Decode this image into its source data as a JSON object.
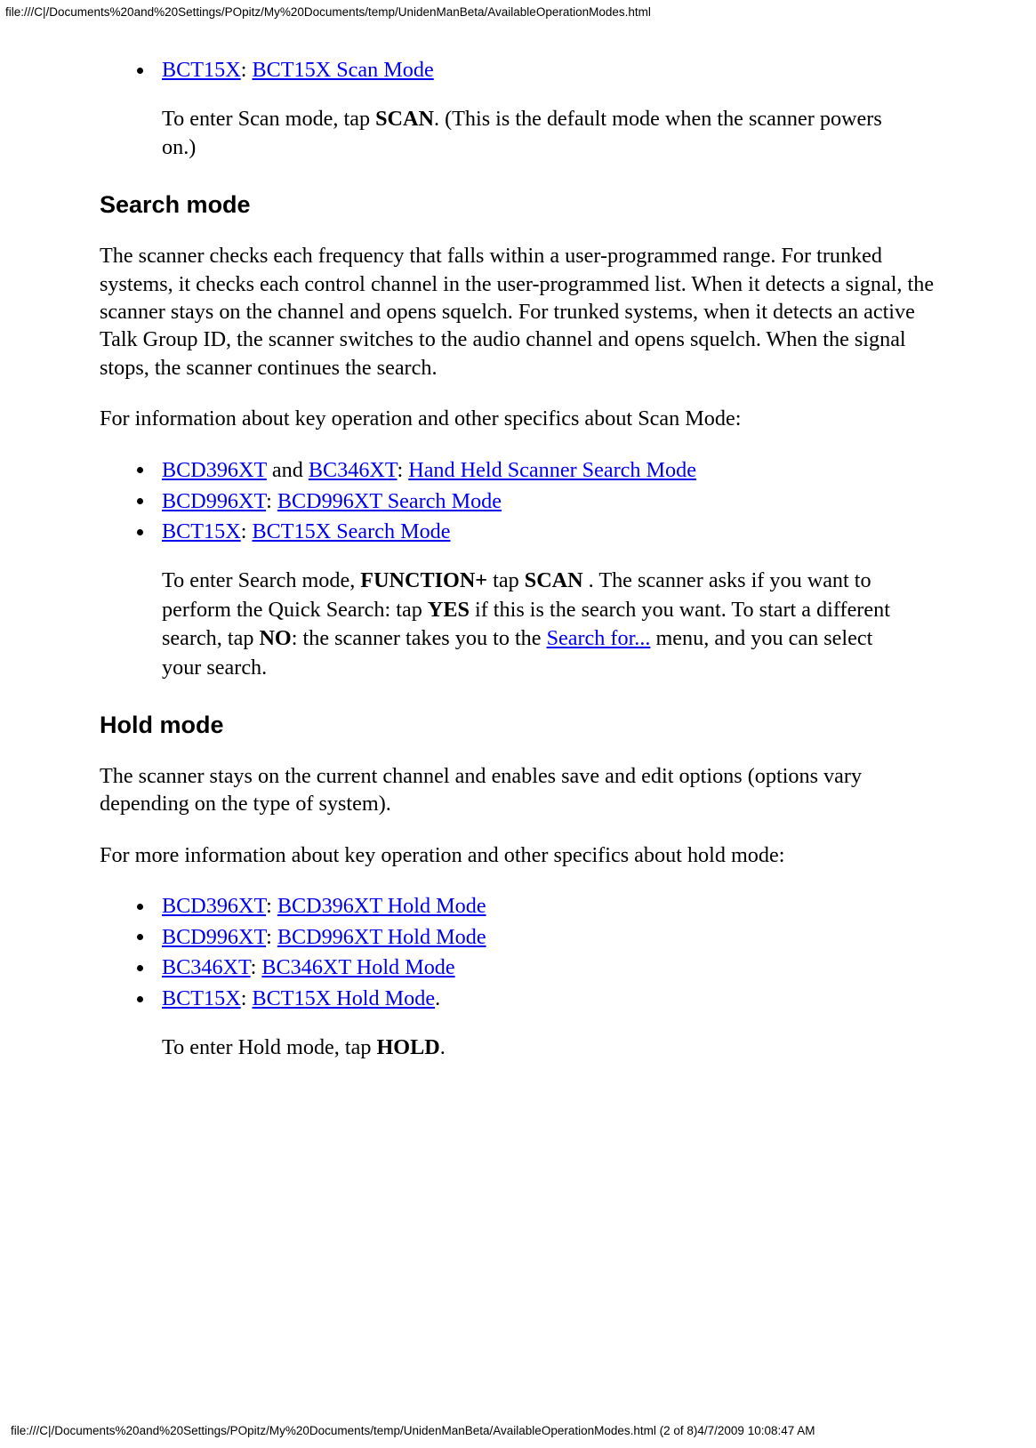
{
  "header_path": "file:///C|/Documents%20and%20Settings/POpitz/My%20Documents/temp/UnidenManBeta/AvailableOperationModes.html",
  "footer_path": "file:///C|/Documents%20and%20Settings/POpitz/My%20Documents/temp/UnidenManBeta/AvailableOperationModes.html (2 of 8)4/7/2009 10:08:47 AM",
  "scan_tail": {
    "link1": "BCT15X",
    "sep": ": ",
    "link2": "BCT15X Scan Mode",
    "note_pre": "To enter Scan mode, tap ",
    "note_bold": "SCAN",
    "note_post": ". (This is the default mode when the scanner powers on.)"
  },
  "search": {
    "heading": "Search mode",
    "para1": "The scanner checks each frequency that falls within a user-programmed range. For trunked systems, it checks each control channel in the user-programmed list. When it detects a signal, the scanner stays on the channel and opens squelch. For trunked systems, when it detects an active Talk Group ID, the scanner switches to the audio channel and opens squelch. When the signal stops, the scanner continues the search.",
    "para2": "For information about key operation and other specifics about Scan Mode:",
    "items": [
      {
        "l1": "BCD396XT",
        "mid": " and ",
        "l2": "BC346XT",
        "sep": ": ",
        "l3": "Hand Held Scanner Search Mode"
      },
      {
        "l1": "BCD996XT",
        "sep": ": ",
        "l3": "BCD996XT Search Mode"
      },
      {
        "l1": "BCT15X",
        "sep": ": ",
        "l3": "BCT15X Search Mode"
      }
    ],
    "note": {
      "t1": "To enter Search mode, ",
      "b1": "FUNCTION+",
      "t2": " tap ",
      "b2": "SCAN",
      "t3": " . The scanner asks if you want to perform the Quick Search: tap ",
      "b3": "YES",
      "t4": " if this is the search you want. To start a different search, tap ",
      "b4": "NO",
      "t5": ": the scanner takes you to the ",
      "link": "Search for...",
      "t6": " menu, and you can select your search."
    }
  },
  "hold": {
    "heading": "Hold mode",
    "para1": "The scanner stays on the current channel and enables save and edit options (options vary depending on the type of system).",
    "para2": "For more information about key operation and other specifics about hold mode:",
    "items": [
      {
        "l1": "BCD396XT",
        "sep": ": ",
        "l3": "BCD396XT Hold Mode"
      },
      {
        "l1": "BCD996XT",
        "sep": ": ",
        "l3": "BCD996XT Hold Mode"
      },
      {
        "l1": "BC346XT",
        "sep": ": ",
        "l3": "BC346XT Hold Mode"
      },
      {
        "l1": "BCT15X",
        "sep": ": ",
        "l3": "BCT15X Hold Mode",
        "trail": "."
      }
    ],
    "note": {
      "t1": "To enter Hold mode, tap ",
      "b1": "HOLD",
      "t2": "."
    }
  }
}
